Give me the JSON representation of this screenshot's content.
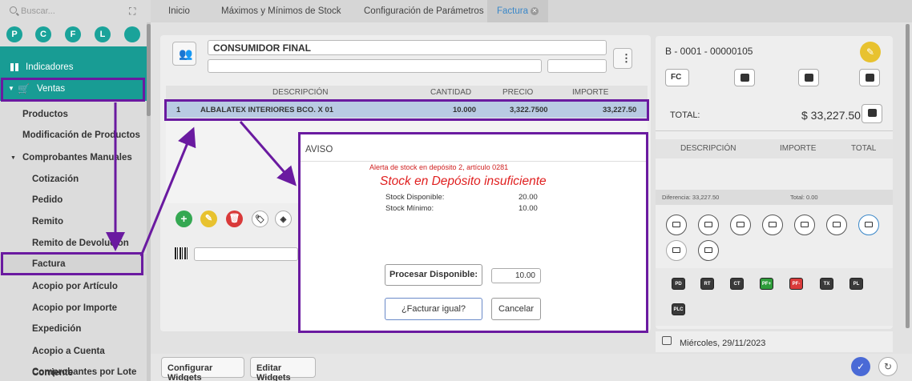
{
  "sidebar": {
    "search_placeholder": "Buscar...",
    "circles": [
      "P",
      "C",
      "F",
      "L",
      ""
    ],
    "indicadores": "Indicadores",
    "ventas": "Ventas",
    "items": [
      "Productos",
      "Modificación de Productos",
      "Comprobantes Manuales",
      "Cotización",
      "Pedido",
      "Remito",
      "Remito de Devolución",
      "Factura",
      "Acopio por Artículo",
      "Acopio por Importe",
      "Expedición",
      "Acopio a Cuenta Corriente",
      "Comprobantes por Lote"
    ]
  },
  "tabs": [
    "Inicio",
    "Máximos y Mínimos de Stock",
    "Configuración de Parámetros",
    "Factura"
  ],
  "client": {
    "name": "CONSUMIDOR FINAL"
  },
  "table": {
    "headers": [
      "DESCRIPCIÓN",
      "CANTIDAD",
      "PRECIO",
      "IMPORTE"
    ],
    "row": {
      "n": "1",
      "desc": "ALBALATEX INTERIORES BCO. X 01",
      "qty": "10.000",
      "price": "3,322.7500",
      "amount": "33,227.50"
    }
  },
  "invoice": {
    "number": "B - 0001 - 00000105",
    "type": "FC",
    "total_label": "TOTAL:",
    "total_value": "$ 33,227.50",
    "pay_headers": [
      "DESCRIPCIÓN",
      "IMPORTE",
      "TOTAL"
    ],
    "diferencia": "Diferencia: 33,227.50",
    "total_small": "Total: 0.00",
    "tags": [
      "PD",
      "RT",
      "CT",
      "PF+",
      "PF-",
      "TX",
      "PL",
      "PLC"
    ],
    "date": "Miércoles, 29/11/2023"
  },
  "modal": {
    "title": "AVISO",
    "alert": "Alerta de stock en depósito 2, artículo 0281",
    "heading": "Stock en Depósito insuficiente",
    "disp_label": "Stock Disponible:",
    "disp_value": "20.00",
    "min_label": "Stock Mínimo:",
    "min_value": "10.00",
    "procesar": "Procesar Disponible:",
    "procesar_value": "10.00",
    "facturar": "¿Facturar igual?",
    "cancelar": "Cancelar"
  },
  "bottom": {
    "configurar": "Configurar Widgets",
    "editar": "Editar Widgets"
  },
  "colors": {
    "accent": "#189c94",
    "highlight": "#6a1aa0",
    "alert": "#e02020"
  }
}
